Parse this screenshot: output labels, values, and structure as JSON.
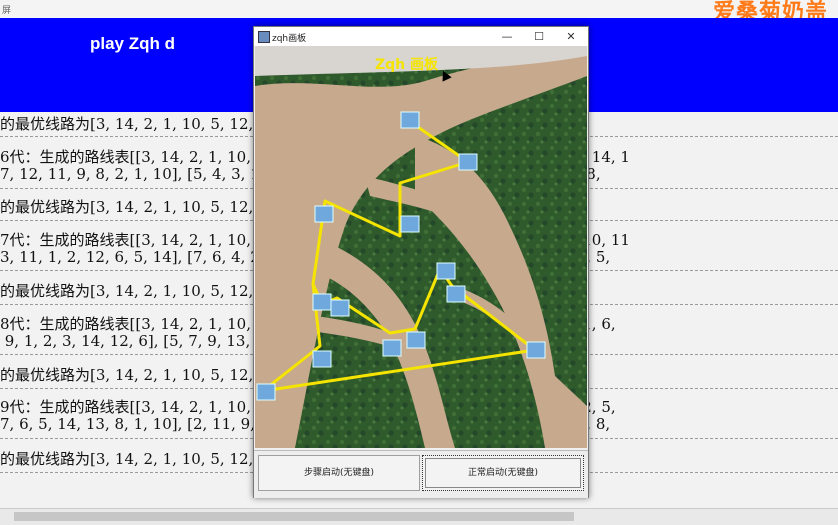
{
  "window": {
    "title": "屏"
  },
  "brand": {
    "text": "爱桑菊奶盖"
  },
  "banner": {
    "title": "play Zqh d"
  },
  "console": {
    "lines": [
      "的最优线路为[3, 14, 2, 1, 10, 5, 12, 8, 4, 9, 6, 7, 11, 13] 最短3454.0",
      "6代：生成的路线表[[3, 14, 2, 1, 10, 5, 12, 8, 4, 9, 6, 7, 11, 13], [10, 9, 7, 6, 4, 3, 14, 1",
      "7, 12, 11, 9, 8, 2, 1, 10], [5, 4, 3, 14, 1, 13, 6, 9, 7, 11, 3, 8, 2, 10], [12, 14, 3, 8,",
      "的最优线路为[3, 14, 2, 1, 10, 5, 12, 8, 4, 9, 6, 7, 11, 13] 最短3454.0",
      "7代：生成的路线表[[3, 14, 2, 1, 10, 5, 12, 8, 4, 9, 6, 7, 11, 13], [12, 14, 3, 4, 1, 10, 11",
      "3, 11, 1, 2, 12, 6, 5, 14], [7, 6, 4, 2, 1, 3, 5, 10, 12, 14, 9, 8, 13, 11], [1, 14, 10, 5,",
      "的最优线路为[3, 14, 2, 1, 10, 5, 12, 8, 4, 9, 6, 7, 11, 13] 最短3454.0",
      "8代：生成的路线表[[3, 14, 2, 1, 10, 5, 12, 8, 4, 9, 6, 7, 11, 13], [2, 8, 11, 9, 10, 1, 6,",
      " 9, 1, 2, 3, 14, 12, 6], [5, 7, 9, 13, 4, 10, 12, 1, 14, 8, 6, 11, 3, 2], [10, 6, 13, 8,",
      "的最优线路为[3, 14, 2, 1, 10, 5, 12, 8, 4, 9, 6, 7, 11, 13] 最短3454.0",
      "9代：生成的路线表[[3, 14, 2, 1, 10, 5, 12, 8, 4, 9, 6, 7, 11, 13], [1, 9, 8, 13, 7, 12, 5,",
      "7, 6, 5, 14, 13, 8, 1, 10], [2, 11, 9, 3, 5, 6, 4, 14, 1, 10, 8, 7, 12, 4, 3], [13, 6, 7, 8,",
      "的最优线路为[3, 14, 2, 1, 10, 5, 12, 8, 4, 9, 6, 7, 11, 13] 最短3454.0"
    ]
  },
  "dialog": {
    "title": "zqh画板",
    "minimize": "—",
    "maximize": "☐",
    "close": "✕",
    "canvas_title": "Zqh 画板",
    "colors": {
      "route": "#f5e400",
      "canvas_title": "#f5e400",
      "water": "#c7a98d",
      "land": "#2f5a2c"
    },
    "button_step": "步骤启动(无键盘)",
    "button_normal": "正常启动(无键盘)"
  }
}
